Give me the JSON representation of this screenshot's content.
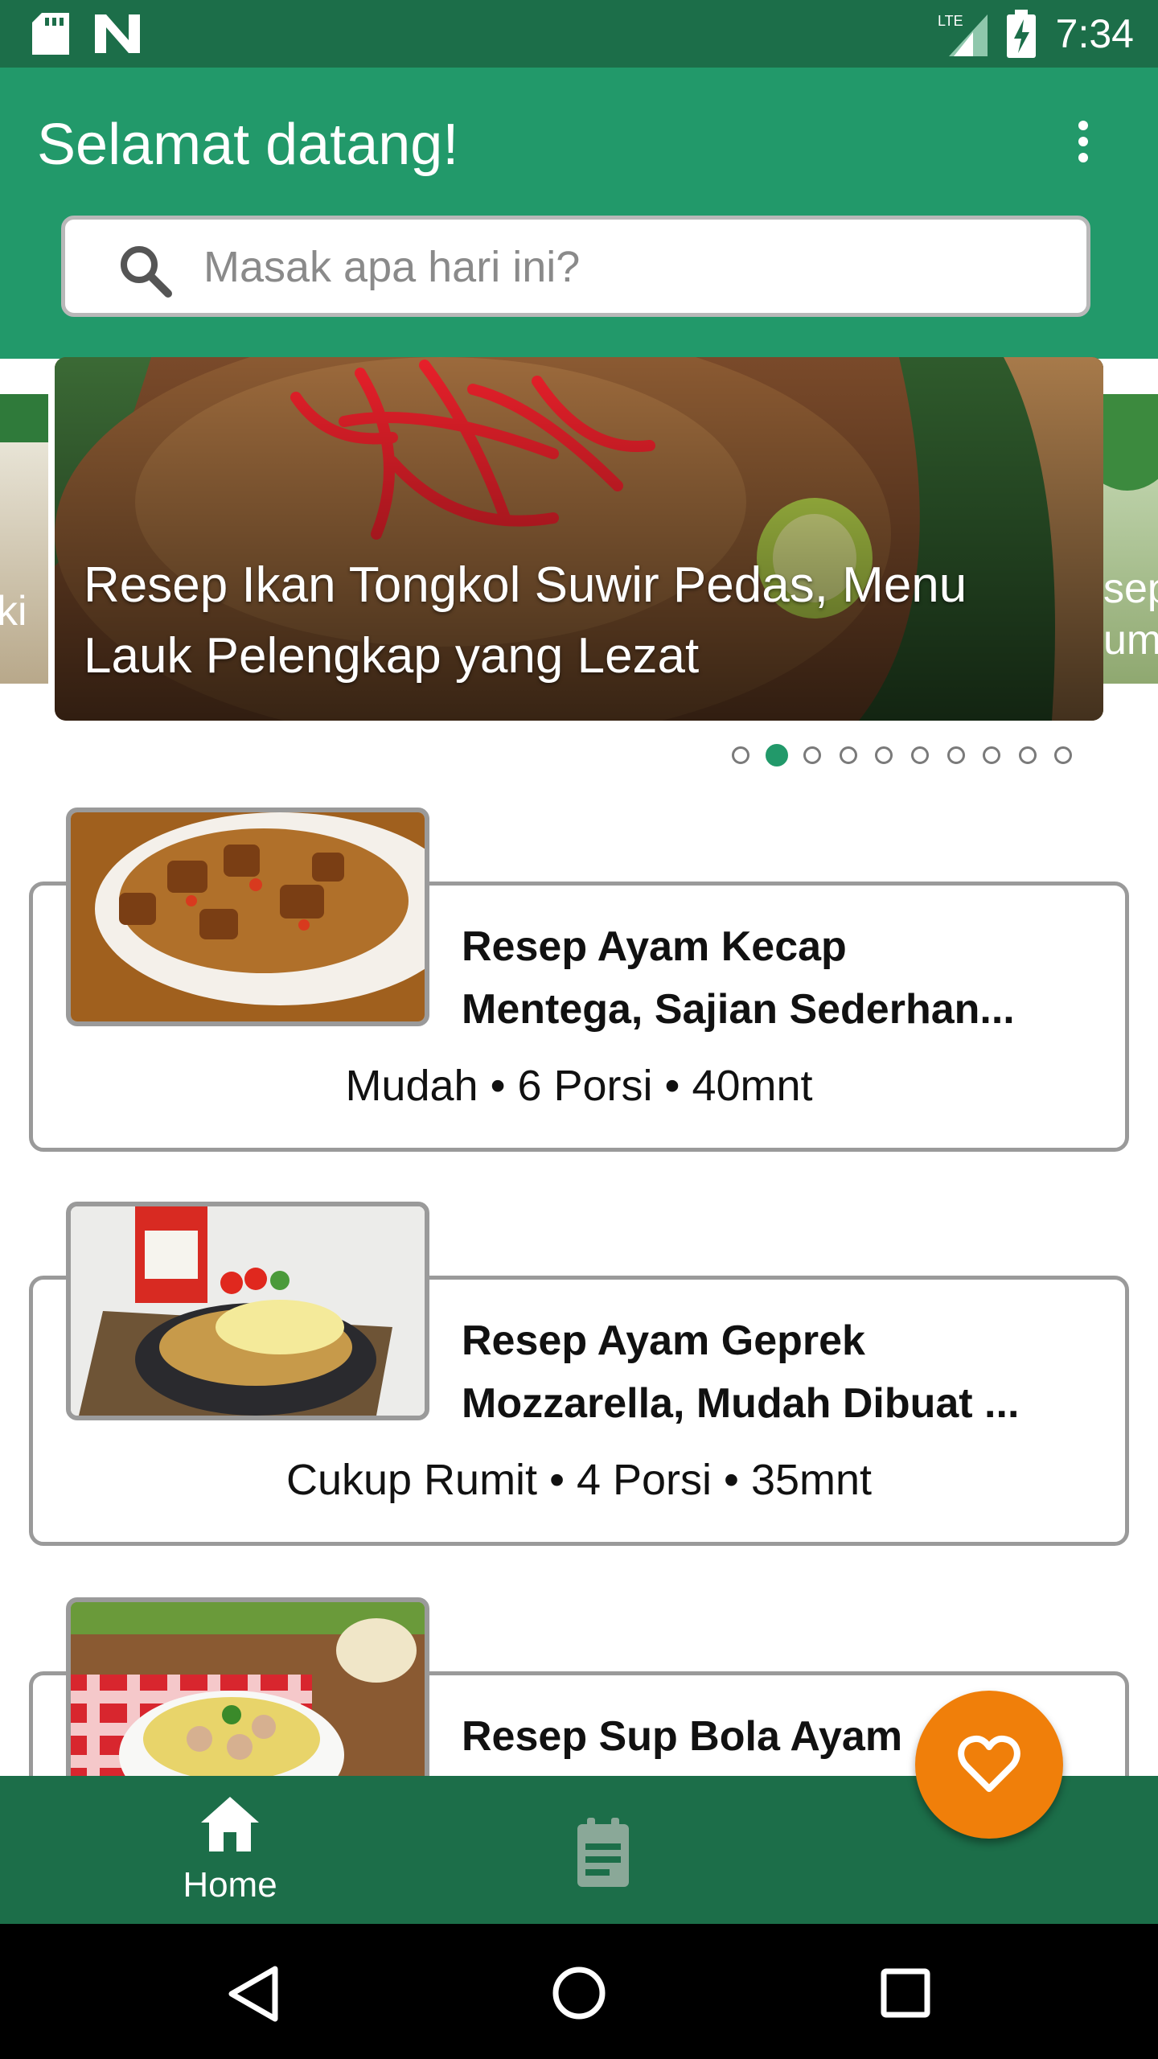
{
  "status_bar": {
    "time": "7:34",
    "network": "LTE"
  },
  "header": {
    "title": "Selamat datang!"
  },
  "search": {
    "placeholder": "Masak apa hari ini?"
  },
  "carousel": {
    "main_caption": "Resep Ikan Tongkol Suwir Pedas, Menu Lauk Pelengkap yang Lezat",
    "left_peek_text": "ki",
    "right_peek_line1": "sep",
    "right_peek_line2": "umi",
    "dot_count": 10,
    "active_dot": 1
  },
  "recipes": [
    {
      "title_line1": "Resep Ayam Kecap",
      "title_line2": "Mentega, Sajian Sederhan...",
      "meta": "Mudah • 6 Porsi • 40mnt"
    },
    {
      "title_line1": "Resep Ayam Geprek",
      "title_line2": "Mozzarella, Mudah Dibuat ...",
      "meta": "Cukup Rumit • 4 Porsi • 35mnt"
    },
    {
      "title_line1": "Resep Sup Bola Ayam",
      "title_line2": "",
      "meta": ""
    }
  ],
  "bottom_nav": {
    "home_label": "Home"
  },
  "colors": {
    "primary": "#22996a",
    "primary_dark": "#1c6e49",
    "fab": "#f07f0a"
  }
}
